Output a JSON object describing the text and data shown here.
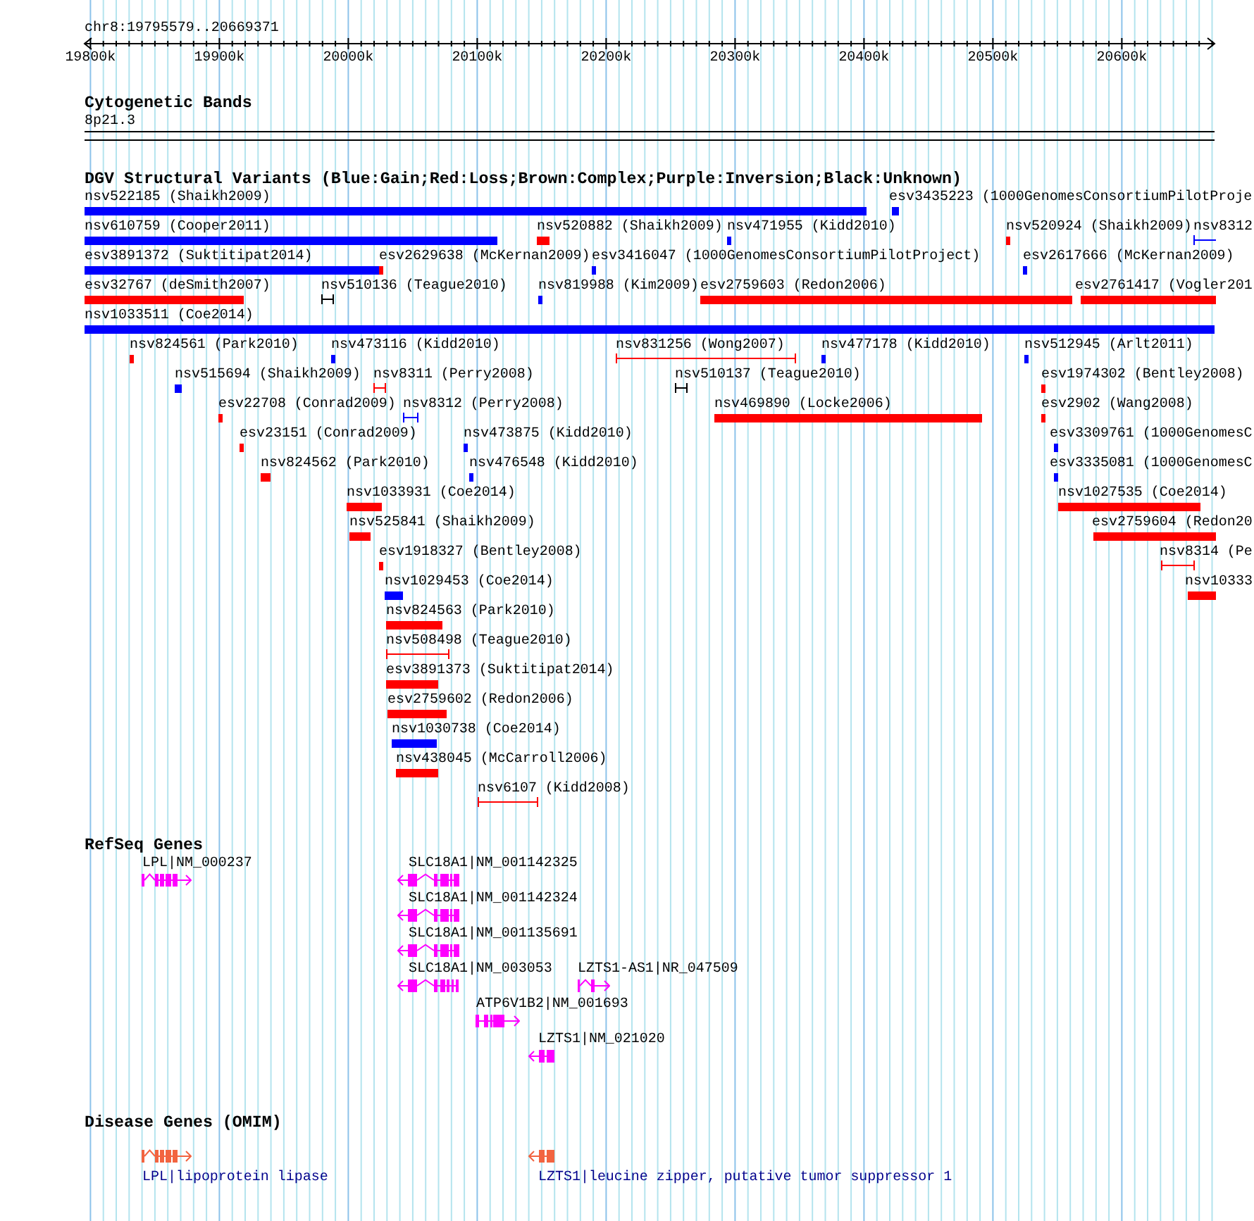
{
  "ruler": {
    "position": "chr8:19795579..20669371",
    "tick_labels": [
      "19800k",
      "19900k",
      "20000k",
      "20100k",
      "20200k",
      "20300k",
      "20400k",
      "20500k",
      "20600k"
    ]
  },
  "cytogenetic_bands": {
    "title": "Cytogenetic Bands",
    "band": "8p21.3"
  },
  "dgv_track": {
    "title": "DGV Structural Variants (Blue:Gain;Red:Loss;Brown:Complex;Purple:Inversion;Black:Unknown)",
    "rows": [
      {
        "variants": [
          {
            "label": "nsv522185 (Shaikh2009)",
            "color": "#0000ff",
            "kind": "bar"
          },
          {
            "label": "esv3435223 (1000GenomesConsortiumPilotProje",
            "color": "#0000ff",
            "kind": "bar"
          }
        ]
      },
      {
        "variants": [
          {
            "label": "nsv610759 (Cooper2011)",
            "color": "#0000ff",
            "kind": "bar"
          },
          {
            "label": "nsv520882 (Shaikh2009)",
            "color": "#ff0000",
            "kind": "bar"
          },
          {
            "label": "nsv471955 (Kidd2010)",
            "color": "#0000ff",
            "kind": "bar"
          },
          {
            "label": "nsv520924 (Shaikh2009)",
            "color": "#ff0000",
            "kind": "bar"
          },
          {
            "label": "nsv8312",
            "color": "#0000ff",
            "kind": "interval"
          }
        ]
      },
      {
        "variants": [
          {
            "label": "esv3891372 (Suktitipat2014)",
            "color": "#0000ff",
            "kind": "bar"
          },
          {
            "label": "esv2629638 (McKernan2009)",
            "color": "#ff0000",
            "kind": "bar"
          },
          {
            "label": "esv3416047 (1000GenomesConsortiumPilotProject)",
            "color": "#0000ff",
            "kind": "bar"
          },
          {
            "label": "esv2617666 (McKernan2009)",
            "color": "#0000ff",
            "kind": "bar"
          }
        ]
      },
      {
        "variants": [
          {
            "label": "esv32767 (deSmith2007)",
            "color": "#ff0000",
            "kind": "bar"
          },
          {
            "label": "nsv510136 (Teague2010)",
            "color": "#000000",
            "kind": "interval"
          },
          {
            "label": "nsv819988 (Kim2009)",
            "color": "#0000ff",
            "kind": "bar"
          },
          {
            "label": "esv2759603 (Redon2006)",
            "color": "#ff0000",
            "kind": "bar"
          },
          {
            "label": "esv2761417 (Vogler201",
            "color": "#ff0000",
            "kind": "bar"
          }
        ]
      },
      {
        "variants": [
          {
            "label": "nsv1033511 (Coe2014)",
            "color": "#0000ff",
            "kind": "bar"
          }
        ]
      },
      {
        "variants": [
          {
            "label": "nsv824561 (Park2010)",
            "color": "#ff0000",
            "kind": "bar"
          },
          {
            "label": "nsv473116 (Kidd2010)",
            "color": "#0000ff",
            "kind": "bar"
          },
          {
            "label": "nsv831256 (Wong2007)",
            "color": "#ff0000",
            "kind": "interval"
          },
          {
            "label": "nsv477178 (Kidd2010)",
            "color": "#0000ff",
            "kind": "bar"
          },
          {
            "label": "nsv512945 (Arlt2011)",
            "color": "#0000ff",
            "kind": "bar"
          }
        ]
      },
      {
        "variants": [
          {
            "label": "nsv515694 (Shaikh2009)",
            "color": "#0000ff",
            "kind": "bar"
          },
          {
            "label": "nsv8311 (Perry2008)",
            "color": "#ff0000",
            "kind": "interval"
          },
          {
            "label": "nsv510137 (Teague2010)",
            "color": "#000000",
            "kind": "interval"
          },
          {
            "label": "esv1974302 (Bentley2008)",
            "color": "#ff0000",
            "kind": "bar"
          }
        ]
      },
      {
        "variants": [
          {
            "label": "esv22708 (Conrad2009)",
            "color": "#ff0000",
            "kind": "bar"
          },
          {
            "label": "nsv8312 (Perry2008)",
            "color": "#0000ff",
            "kind": "interval"
          },
          {
            "label": "nsv469890 (Locke2006)",
            "color": "#ff0000",
            "kind": "bar"
          },
          {
            "label": "esv2902 (Wang2008)",
            "color": "#ff0000",
            "kind": "bar"
          }
        ]
      },
      {
        "variants": [
          {
            "label": "esv23151 (Conrad2009)",
            "color": "#ff0000",
            "kind": "bar"
          },
          {
            "label": "nsv473875 (Kidd2010)",
            "color": "#0000ff",
            "kind": "bar"
          },
          {
            "label": "esv3309761 (1000GenomesC",
            "color": "#0000ff",
            "kind": "bar"
          }
        ]
      },
      {
        "variants": [
          {
            "label": "nsv824562 (Park2010)",
            "color": "#ff0000",
            "kind": "bar"
          },
          {
            "label": "nsv476548 (Kidd2010)",
            "color": "#0000ff",
            "kind": "bar"
          },
          {
            "label": "esv3335081 (1000GenomesC",
            "color": "#0000ff",
            "kind": "bar"
          }
        ]
      },
      {
        "variants": [
          {
            "label": "nsv1033931 (Coe2014)",
            "color": "#ff0000",
            "kind": "bar"
          },
          {
            "label": "nsv1027535 (Coe2014)",
            "color": "#ff0000",
            "kind": "bar"
          }
        ]
      },
      {
        "variants": [
          {
            "label": "nsv525841 (Shaikh2009)",
            "color": "#ff0000",
            "kind": "bar"
          },
          {
            "label": "esv2759604 (Redon20",
            "color": "#ff0000",
            "kind": "bar"
          }
        ]
      },
      {
        "variants": [
          {
            "label": "esv1918327 (Bentley2008)",
            "color": "#ff0000",
            "kind": "bar"
          },
          {
            "label": "nsv8314 (Pe",
            "color": "#ff0000",
            "kind": "interval"
          }
        ]
      },
      {
        "variants": [
          {
            "label": "nsv1029453 (Coe2014)",
            "color": "#0000ff",
            "kind": "bar"
          },
          {
            "label": "nsv10333",
            "color": "#ff0000",
            "kind": "bar"
          }
        ]
      },
      {
        "variants": [
          {
            "label": "nsv824563 (Park2010)",
            "color": "#ff0000",
            "kind": "bar"
          }
        ]
      },
      {
        "variants": [
          {
            "label": "nsv508498 (Teague2010)",
            "color": "#ff0000",
            "kind": "interval"
          }
        ]
      },
      {
        "variants": [
          {
            "label": "esv3891373 (Suktitipat2014)",
            "color": "#ff0000",
            "kind": "bar"
          }
        ]
      },
      {
        "variants": [
          {
            "label": "esv2759602 (Redon2006)",
            "color": "#ff0000",
            "kind": "bar"
          }
        ]
      },
      {
        "variants": [
          {
            "label": "nsv1030738 (Coe2014)",
            "color": "#0000ff",
            "kind": "bar"
          }
        ]
      },
      {
        "variants": [
          {
            "label": "nsv438045 (McCarroll2006)",
            "color": "#ff0000",
            "kind": "bar"
          }
        ]
      },
      {
        "variants": [
          {
            "label": "nsv6107 (Kidd2008)",
            "color": "#ff0000",
            "kind": "interval"
          }
        ]
      }
    ]
  },
  "refseq_track": {
    "title": "RefSeq Genes",
    "genes": [
      {
        "label": "LPL|NM_000237",
        "reverse": false
      },
      {
        "label": "SLC18A1|NM_001142325",
        "reverse": true
      },
      {
        "label": "SLC18A1|NM_001142324",
        "reverse": true
      },
      {
        "label": "SLC18A1|NM_001135691",
        "reverse": true
      },
      {
        "label": "SLC18A1|NM_003053",
        "reverse": true
      },
      {
        "label": "LZTS1-AS1|NR_047509",
        "reverse": false
      },
      {
        "label": "ATP6V1B2|NM_001693",
        "reverse": false
      },
      {
        "label": "LZTS1|NM_021020",
        "reverse": true
      }
    ]
  },
  "omim_track": {
    "title": "Disease Genes (OMIM)",
    "genes": [
      {
        "label": "LPL|lipoprotein lipase",
        "reverse": false
      },
      {
        "label": "LZTS1|leucine zipper, putative tumor suppressor 1",
        "reverse": true
      }
    ]
  }
}
